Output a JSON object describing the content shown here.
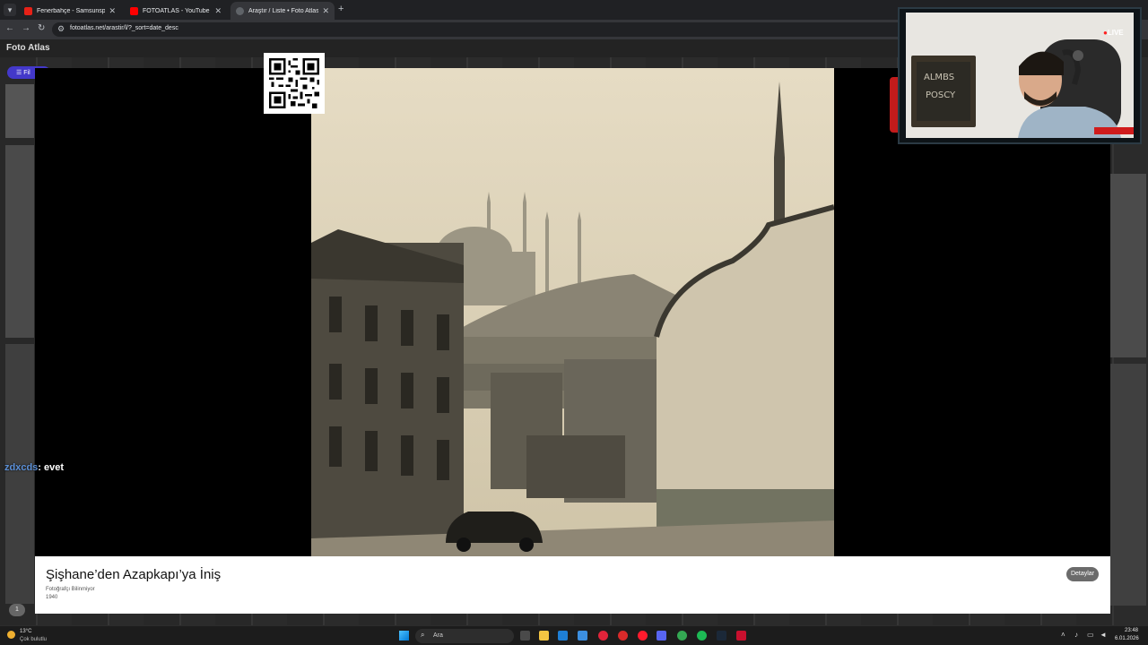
{
  "browser": {
    "tabs": [
      {
        "title": "Fenerbahçe - Samsunspor Maç",
        "close": "✕"
      },
      {
        "title": "FOTOATLAS - YouTube",
        "close": "✕"
      },
      {
        "title": "Araştır / Liste • Foto Atlas",
        "close": "✕"
      }
    ],
    "new_tab": "+",
    "menu_glyph": "▾",
    "back_glyph": "←",
    "forward_glyph": "→",
    "reload_glyph": "↻",
    "address": "fotoatlas.net/arastir/l/?_sort=date_desc"
  },
  "site": {
    "title": "Foto Atlas",
    "filter_label": "Fil",
    "pager_label": "1"
  },
  "lightbox": {
    "title": "Şişhane’den Azapkapı’ya İniş",
    "photographer": "Fotoğrafçı Bilinmiyor",
    "year": "1940",
    "details_button": "Detaylar"
  },
  "chat": {
    "user": "zdxcds",
    "message": ": evet"
  },
  "stream": {
    "live_label": "LIVE"
  },
  "taskbar": {
    "weather_temp": "13°C",
    "weather_condition": "Çok bulutlu",
    "search_placeholder": "Ara",
    "time": "23:48",
    "date": "6.01.2026"
  }
}
